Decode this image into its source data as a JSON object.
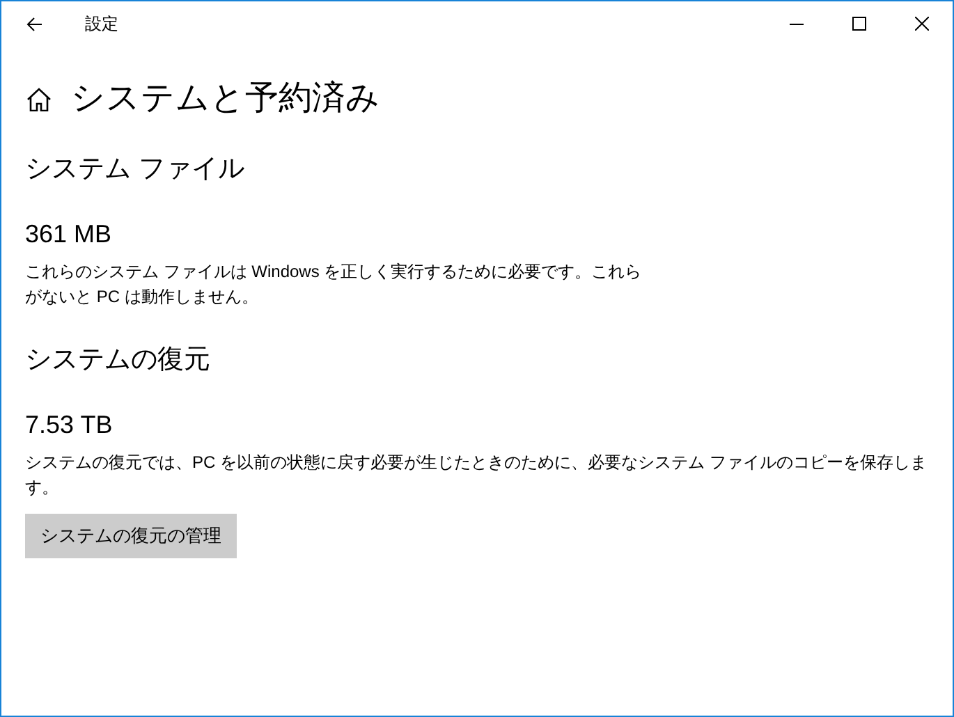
{
  "window": {
    "title": "設定"
  },
  "page": {
    "title": "システムと予約済み"
  },
  "sections": [
    {
      "heading": "システム ファイル",
      "size": "361 MB",
      "description": "これらのシステム ファイルは Windows を正しく実行するために必要です。これらがないと PC は動作しません。"
    },
    {
      "heading": "システムの復元",
      "size": "7.53 TB",
      "description": "システムの復元では、PC を以前の状態に戻す必要が生じたときのために、必要なシステム ファイルのコピーを保存します。",
      "button": "システムの復元の管理"
    }
  ]
}
